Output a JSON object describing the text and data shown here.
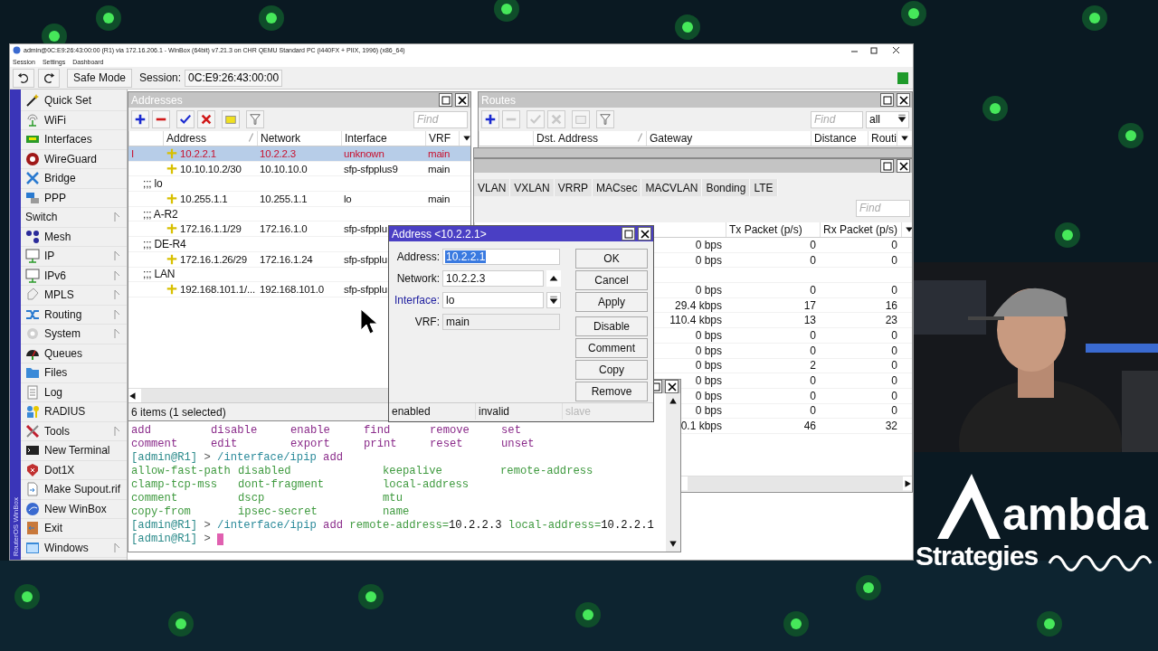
{
  "window": {
    "title": "admin@0C:E9:26:43:00:00 (R1) via 172.16.206.1 - WinBox (64bit) v7.21.3 on CHR QEMU Standard PC (i440FX + PIIX, 1996) (x86_64)"
  },
  "menu": [
    "Session",
    "Settings",
    "Dashboard"
  ],
  "toolbar": {
    "safe_mode": "Safe Mode",
    "session_label": "Session:",
    "session_value": "0C:E9:26:43:00:00"
  },
  "sidebar": {
    "brand": "RouterOS WinBox",
    "items": [
      {
        "label": "Quick Set",
        "submenu": false
      },
      {
        "label": "WiFi",
        "submenu": false
      },
      {
        "label": "Interfaces",
        "submenu": false
      },
      {
        "label": "WireGuard",
        "submenu": false
      },
      {
        "label": "Bridge",
        "submenu": false
      },
      {
        "label": "PPP",
        "submenu": false
      },
      {
        "label": "Switch",
        "submenu": true
      },
      {
        "label": "Mesh",
        "submenu": false
      },
      {
        "label": "IP",
        "submenu": true
      },
      {
        "label": "IPv6",
        "submenu": true
      },
      {
        "label": "MPLS",
        "submenu": true
      },
      {
        "label": "Routing",
        "submenu": true
      },
      {
        "label": "System",
        "submenu": true
      },
      {
        "label": "Queues",
        "submenu": false
      },
      {
        "label": "Files",
        "submenu": false
      },
      {
        "label": "Log",
        "submenu": false
      },
      {
        "label": "RADIUS",
        "submenu": false
      },
      {
        "label": "Tools",
        "submenu": true
      },
      {
        "label": "New Terminal",
        "submenu": false
      },
      {
        "label": "Dot1X",
        "submenu": false
      },
      {
        "label": "Make Supout.rif",
        "submenu": false
      },
      {
        "label": "New WinBox",
        "submenu": false
      },
      {
        "label": "Exit",
        "submenu": false
      },
      {
        "label": "Windows",
        "submenu": true
      }
    ]
  },
  "addresses": {
    "title": "Addresses",
    "tools": [
      {
        "kind": "add",
        "disabled": false
      },
      {
        "kind": "remove",
        "disabled": false
      },
      {
        "kind": "enable",
        "disabled": false
      },
      {
        "kind": "disable",
        "disabled": false
      },
      {
        "kind": "comment",
        "disabled": false
      },
      {
        "kind": "filter",
        "disabled": false
      }
    ],
    "find_placeholder": "Find",
    "columns": [
      "Address",
      "Network",
      "Interface",
      "VRF"
    ],
    "rows": [
      {
        "kind": "entry",
        "flag": "I",
        "selected": true,
        "invalid": true,
        "cells": [
          "10.2.2.1",
          "10.2.2.3",
          "unknown",
          "main"
        ]
      },
      {
        "kind": "entry",
        "selected": false,
        "invalid": false,
        "cells": [
          "10.10.10.2/30",
          "10.10.10.0",
          "sfp-sfpplus9",
          "main"
        ]
      },
      {
        "kind": "comment",
        "text": ";;; lo"
      },
      {
        "kind": "entry",
        "selected": false,
        "invalid": false,
        "cells": [
          "10.255.1.1",
          "10.255.1.1",
          "lo",
          "main"
        ]
      },
      {
        "kind": "comment",
        "text": ";;; A-R2"
      },
      {
        "kind": "entry",
        "selected": false,
        "invalid": false,
        "cells": [
          "172.16.1.1/29",
          "172.16.1.0",
          "sfp-sfpplu"
        ]
      },
      {
        "kind": "comment",
        "text": ";;; DE-R4"
      },
      {
        "kind": "entry",
        "selected": false,
        "invalid": false,
        "cells": [
          "172.16.1.26/29",
          "172.16.1.24",
          "sfp-sfpplu"
        ]
      },
      {
        "kind": "comment",
        "text": ";;; LAN"
      },
      {
        "kind": "entry",
        "selected": false,
        "invalid": false,
        "cells": [
          "192.168.101.1/...",
          "192.168.101.0",
          "sfp-sfpplu"
        ]
      }
    ],
    "status": "6 items (1 selected)"
  },
  "routes": {
    "title": "Routes",
    "tools": [
      {
        "kind": "add",
        "disabled": false
      },
      {
        "kind": "remove",
        "disabled": true
      },
      {
        "kind": "enable",
        "disabled": true
      },
      {
        "kind": "disable",
        "disabled": true
      },
      {
        "kind": "comment",
        "disabled": true
      },
      {
        "kind": "filter",
        "disabled": false
      }
    ],
    "find_placeholder": "Find",
    "filter_value": "all",
    "columns": [
      "Dst. Address",
      "Gateway",
      "Distance",
      "Routi"
    ]
  },
  "interfaces": {
    "tabs": [
      "VLAN",
      "VXLAN",
      "VRRP",
      "MACsec",
      "MACVLAN",
      "Bonding",
      "LTE"
    ],
    "find_placeholder": "Find",
    "columns": [
      "Tx Packet (p/s)",
      "Rx Packet (p/s)"
    ],
    "rows": [
      {
        "kind": "entry",
        "cells": [
          "0 bps",
          "0",
          "0"
        ]
      },
      {
        "kind": "entry",
        "cells": [
          "0 bps",
          "0",
          "0"
        ]
      },
      {
        "kind": "comment"
      },
      {
        "kind": "entry",
        "cells": [
          "0 bps",
          "0",
          "0"
        ]
      },
      {
        "kind": "entry",
        "cells": [
          "29.4 kbps",
          "17",
          "16"
        ]
      },
      {
        "kind": "entry",
        "cells": [
          "110.4 kbps",
          "13",
          "23"
        ]
      },
      {
        "kind": "entry",
        "cells": [
          "0 bps",
          "0",
          "0"
        ]
      },
      {
        "kind": "entry",
        "cells": [
          "0 bps",
          "0",
          "0"
        ]
      },
      {
        "kind": "entry",
        "cells": [
          "0 bps",
          "2",
          "0"
        ]
      },
      {
        "kind": "entry",
        "cells": [
          "0 bps",
          "0",
          "0"
        ]
      },
      {
        "kind": "entry",
        "cells": [
          "0 bps",
          "0",
          "0"
        ]
      },
      {
        "kind": "entry",
        "cells": [
          "0 bps",
          "0",
          "0"
        ]
      },
      {
        "kind": "entry",
        "cells": [
          "0.1 kbps",
          "46",
          "32"
        ]
      }
    ]
  },
  "terminal": {
    "lines": [
      {
        "kind": "commands",
        "words": [
          "add",
          "disable",
          "enable",
          "find",
          "remove",
          "set"
        ]
      },
      {
        "kind": "commands",
        "words": [
          "comment",
          "edit",
          "export",
          "print",
          "reset",
          "unset"
        ]
      },
      {
        "kind": "prompt",
        "prompt": "[admin@R1]",
        "caret": ">",
        "cursor": false,
        "segments": [
          {
            "kind": "path",
            "text": "/interface/ipip"
          },
          {
            "kind": "command",
            "text": "add"
          }
        ]
      },
      {
        "kind": "params",
        "words": [
          "allow-fast-path",
          "disabled",
          "keepalive",
          "remote-address"
        ]
      },
      {
        "kind": "params",
        "words": [
          "clamp-tcp-mss",
          "dont-fragment",
          "local-address"
        ]
      },
      {
        "kind": "params",
        "words": [
          "comment",
          "dscp",
          "mtu"
        ]
      },
      {
        "kind": "params",
        "words": [
          "copy-from",
          "ipsec-secret",
          "name"
        ]
      },
      {
        "kind": "prompt",
        "prompt": "[admin@R1]",
        "caret": ">",
        "cursor": false,
        "segments": [
          {
            "kind": "path",
            "text": "/interface/ipip"
          },
          {
            "kind": "command",
            "text": "add"
          },
          {
            "kind": "param",
            "text": "remote-address="
          },
          {
            "kind": "value",
            "text": "10.2.2.3"
          },
          {
            "kind": "param",
            "text": "local-address="
          },
          {
            "kind": "value",
            "text": "10.2.2.1"
          }
        ]
      },
      {
        "kind": "prompt",
        "prompt": "[admin@R1]",
        "caret": ">",
        "cursor": true
      }
    ]
  },
  "dialog": {
    "title": "Address <10.2.2.1>",
    "fields": [
      {
        "kind": "text",
        "label": "Address:",
        "value": "10.2.2.1",
        "selected": true,
        "link": false
      },
      {
        "kind": "spin",
        "label": "Network:",
        "value": "10.2.2.3",
        "selected": false,
        "link": false
      },
      {
        "kind": "select",
        "label": "Interface:",
        "value": "lo",
        "selected": false,
        "link": true
      },
      {
        "kind": "readonly",
        "label": "VRF:",
        "value": "main",
        "selected": false,
        "link": false
      }
    ],
    "buttons": [
      "OK",
      "Cancel",
      "Apply",
      "Disable",
      "Comment",
      "Copy",
      "Remove"
    ],
    "status": [
      {
        "text": "enabled",
        "disabled": false
      },
      {
        "text": "invalid",
        "disabled": false
      },
      {
        "text": "slave",
        "disabled": true
      }
    ]
  },
  "logo": {
    "word": "ambda",
    "tagline": "Strategies"
  }
}
